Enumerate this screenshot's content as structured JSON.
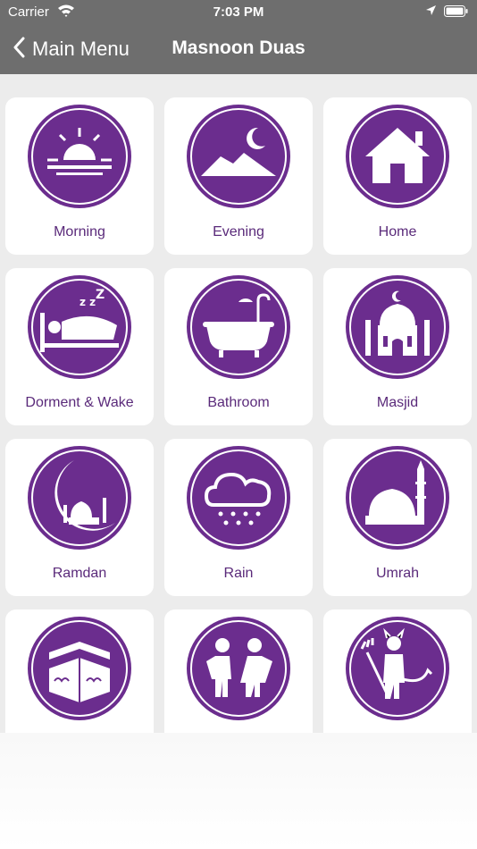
{
  "status_bar": {
    "carrier": "Carrier",
    "time": "7:03 PM"
  },
  "navbar": {
    "back_label": "Main Menu",
    "title": "Masnoon Duas"
  },
  "colors": {
    "header_bg": "#6e6e6e",
    "accent_purple": "#6b2d8e",
    "content_bg": "#ececec",
    "label_text": "#5a2a7a"
  },
  "tiles": [
    {
      "label": "Morning",
      "icon": "sunrise-icon"
    },
    {
      "label": "Evening",
      "icon": "moon-mountain-icon"
    },
    {
      "label": "Home",
      "icon": "house-icon"
    },
    {
      "label": "Dorment & Wake",
      "icon": "sleeping-bed-icon"
    },
    {
      "label": "Bathroom",
      "icon": "bathtub-icon"
    },
    {
      "label": "Masjid",
      "icon": "mosque-icon"
    },
    {
      "label": "Ramdan",
      "icon": "crescent-mosque-icon"
    },
    {
      "label": "Rain",
      "icon": "rain-cloud-icon"
    },
    {
      "label": "Umrah",
      "icon": "dome-minaret-icon"
    },
    {
      "label": "",
      "icon": "kaaba-icon"
    },
    {
      "label": "",
      "icon": "children-icon"
    },
    {
      "label": "",
      "icon": "devil-pitchfork-icon"
    }
  ]
}
